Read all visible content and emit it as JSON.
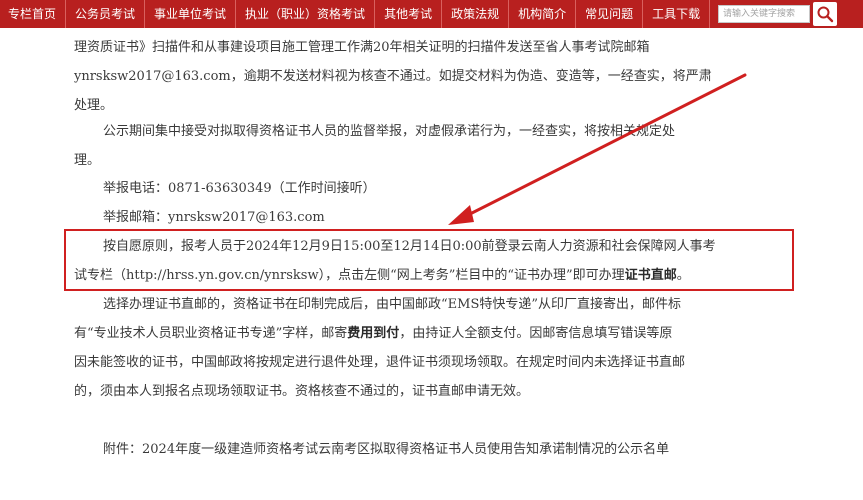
{
  "nav": {
    "items": [
      "专栏首页",
      "公务员考试",
      "事业单位考试",
      "执业（职业）资格考试",
      "其他考试",
      "政策法规",
      "机构简介",
      "常见问题",
      "工具下载"
    ],
    "search_placeholder": "请输入关键字搜索",
    "search_icon": "search-icon",
    "bar_color": "#b8201f"
  },
  "content": {
    "p1_l1": "理资质证书》扫描件和从事建设项目施工管理工作满20年相关证明的扫描件发送至省人事考试院邮箱",
    "p1_l2": "ynrsksw2017@163.com，逾期不发送材料视为核查不通过。如提交材料为伪造、变造等，一经查实，将严肃",
    "p1_l3": "处理。",
    "p2_l1": "公示期间集中接受对拟取得资格证书人员的监督举报，对虚假承诺行为，一经查实，将按相关规定处",
    "p2_l2": "理。",
    "phone": "举报电话：0871-63630349（工作时间接听）",
    "email": "举报邮箱：ynrsksw2017@163.com",
    "h_l1": "按自愿原则，报考人员于2024年12月9日15:00至12月14日0:00前登录云南人力资源和社会保障网人事考",
    "h_l2_pre": "试专栏（http://hrss.yn.gov.cn/ynrsksw），点击左侧“网上考务”栏目中的“证书办理”即可办理",
    "h_l2_bold": "证书直邮",
    "h_l2_post": "。",
    "p3_l1": "选择办理证书直邮的，资格证书在印制完成后，由中国邮政“EMS特快专递”从印厂直接寄出，邮件标",
    "p3_l2_pre": "有“专业技术人员职业资格证书专递”字样，邮寄",
    "p3_l2_bold": "费用到付",
    "p3_l2_post": "，由持证人全额支付。因邮寄信息填写错误等原",
    "p3_l3": "因未能签收的证书，中国邮政将按规定进行退件处理，退件证书须现场领取。在规定时间内未选择证书直邮",
    "p3_l4": "的，须由本人到报名点现场领取证书。资格核查不通过的，证书直邮申请无效。",
    "attachment": "附件：2024年度一级建造师资格考试云南考区拟取得资格证书人员使用告知承诺制情况的公示名单"
  },
  "annotation": {
    "box_color": "#d02020",
    "arrow_color": "#d02020"
  }
}
